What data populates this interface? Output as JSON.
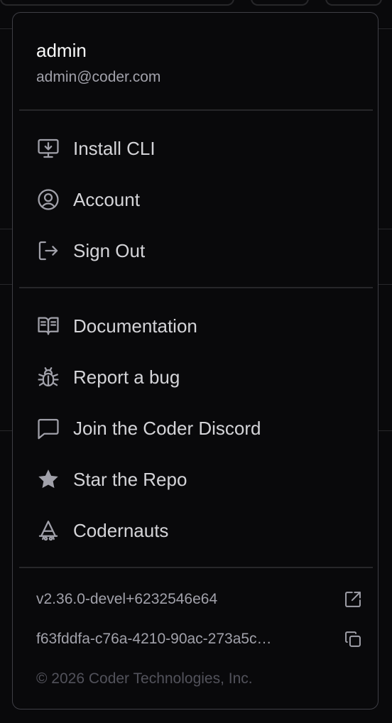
{
  "user": {
    "name": "admin",
    "email": "admin@coder.com"
  },
  "account_items": [
    {
      "label": "Install CLI",
      "icon": "monitor-download-icon"
    },
    {
      "label": "Account",
      "icon": "user-circle-icon"
    },
    {
      "label": "Sign Out",
      "icon": "log-out-icon"
    }
  ],
  "support_items": [
    {
      "label": "Documentation",
      "icon": "book-open-icon"
    },
    {
      "label": "Report a bug",
      "icon": "bug-icon"
    },
    {
      "label": "Join the Coder Discord",
      "icon": "message-square-icon"
    },
    {
      "label": "Star the Repo",
      "icon": "star-icon"
    },
    {
      "label": "Codernauts",
      "icon": "codernauts-icon"
    }
  ],
  "build": {
    "version": "v2.36.0-devel+6232546e64",
    "deployment_id": "f63fddfa-c76a-4210-90ac-273a5c…",
    "copyright": "© 2026 Coder Technologies, Inc."
  },
  "colors": {
    "background": "#09090b",
    "border": "#3f3f46",
    "divider": "#27272a",
    "text_primary": "#fafafa",
    "text_item": "#d4d4d8",
    "text_muted": "#a1a1aa",
    "text_faint": "#52525b"
  }
}
